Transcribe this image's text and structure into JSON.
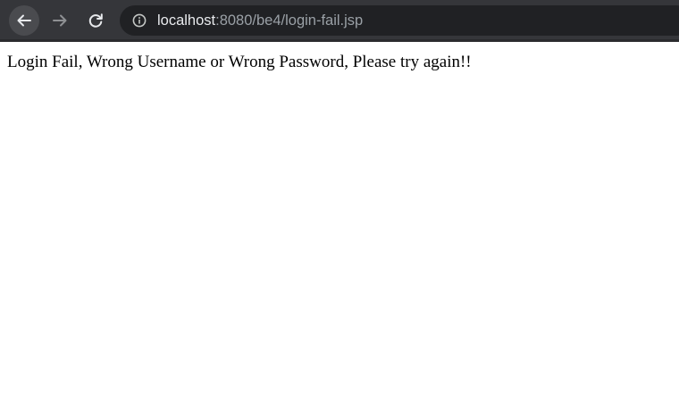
{
  "browser": {
    "url_host": "localhost",
    "url_rest": ":8080/be4/login-fail.jsp",
    "toolbar_color": "#35363a",
    "omnibox_color": "#202124",
    "icons": {
      "back": "arrow-left-icon",
      "forward": "arrow-right-icon",
      "reload": "reload-icon",
      "site_info": "info-circle-icon"
    }
  },
  "page": {
    "message": "Login Fail, Wrong Username or Wrong Password, Please try again!!"
  }
}
